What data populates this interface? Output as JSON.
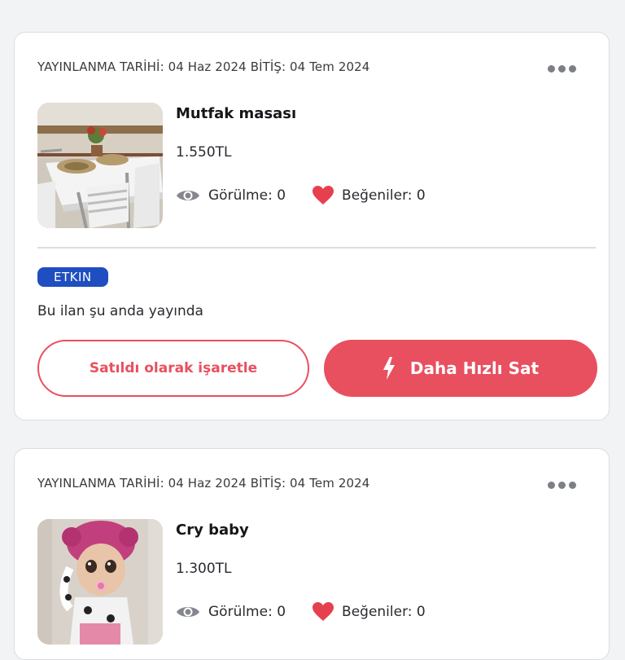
{
  "listings": [
    {
      "published_label": "YAYINLANMA TARİHİ: 04 Haz 2024 BİTİŞ: 04 Tem 2024",
      "title": "Mutfak masası",
      "price": "1.550TL",
      "views_label": "Görülme: 0",
      "likes_label": "Beğeniler: 0",
      "status_badge": "ETKIN",
      "status_text": "Bu ilan şu anda yayında",
      "mark_sold_label": "Satıldı olarak işaretle",
      "sell_faster_label": "Daha Hızlı Sat",
      "image_icon": "kitchen-table-photo"
    },
    {
      "published_label": "YAYINLANMA TARİHİ: 04 Haz 2024 BİTİŞ: 04 Tem 2024",
      "title": "Cry baby",
      "price": "1.300TL",
      "views_label": "Görülme: 0",
      "likes_label": "Beğeniler: 0",
      "image_icon": "doll-photo"
    }
  ],
  "colors": {
    "accent": "#e8505f",
    "badge": "#1f4ec1",
    "background": "#f2f3f5",
    "card": "#ffffff"
  },
  "icons": {
    "more": "more-dots-icon",
    "views": "eye-icon",
    "likes": "heart-icon",
    "boost": "lightning-icon"
  }
}
